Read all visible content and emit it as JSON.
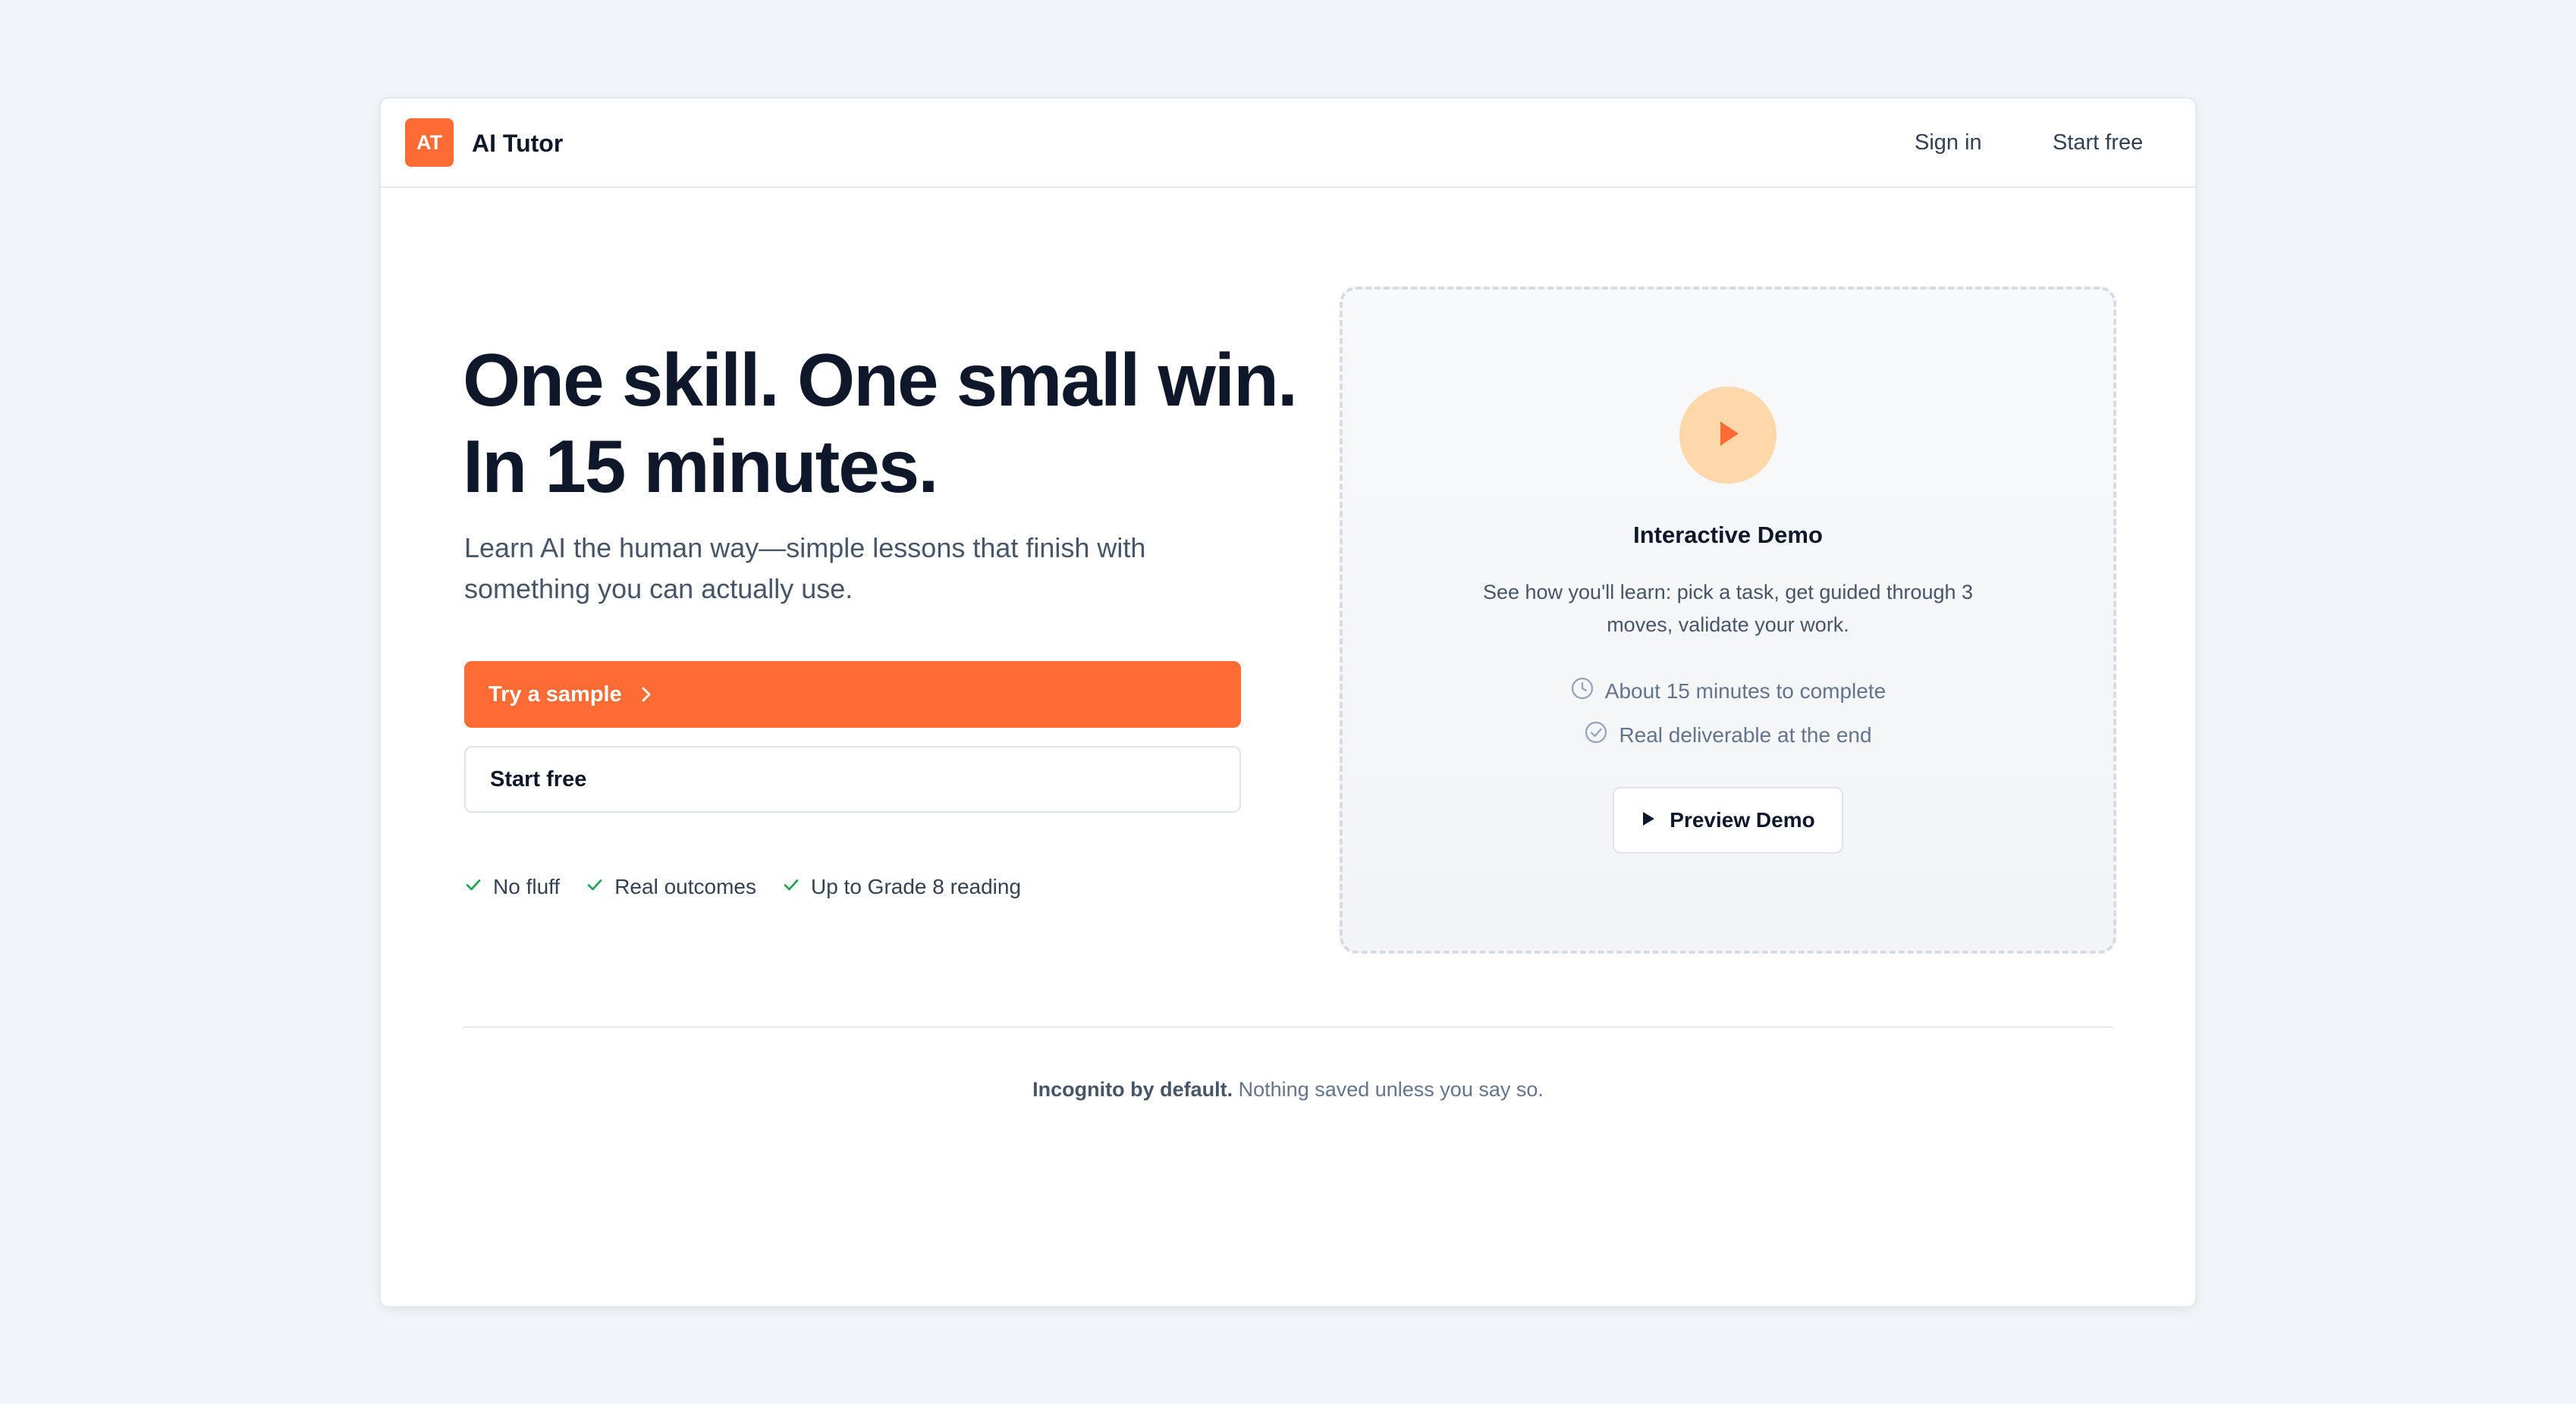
{
  "header": {
    "logo_text": "AT",
    "brand": "AI Tutor",
    "nav": {
      "sign_in": "Sign in",
      "start_free": "Start free"
    }
  },
  "hero": {
    "title": "One skill. One small win. In 15 minutes.",
    "subtitle": "Learn AI the human way—simple lessons that finish with something you can actually use.",
    "primary_button": "Try a sample",
    "secondary_button": "Start free",
    "badges": [
      "No fluff",
      "Real outcomes",
      "Up to Grade 8 reading"
    ]
  },
  "demo": {
    "title": "Interactive Demo",
    "description": "See how you'll learn: pick a task, get guided through 3 moves, validate your work.",
    "feature_time": "About 15 minutes to complete",
    "feature_deliverable": "Real deliverable at the end",
    "preview_button": "Preview Demo"
  },
  "footer": {
    "strong": "Incognito by default.",
    "text": "Nothing saved unless you say so."
  },
  "colors": {
    "accent": "#ff6b35",
    "play_circle": "#fed7aa",
    "check_green": "#16a34a",
    "page_bg": "#f1f4f8"
  }
}
